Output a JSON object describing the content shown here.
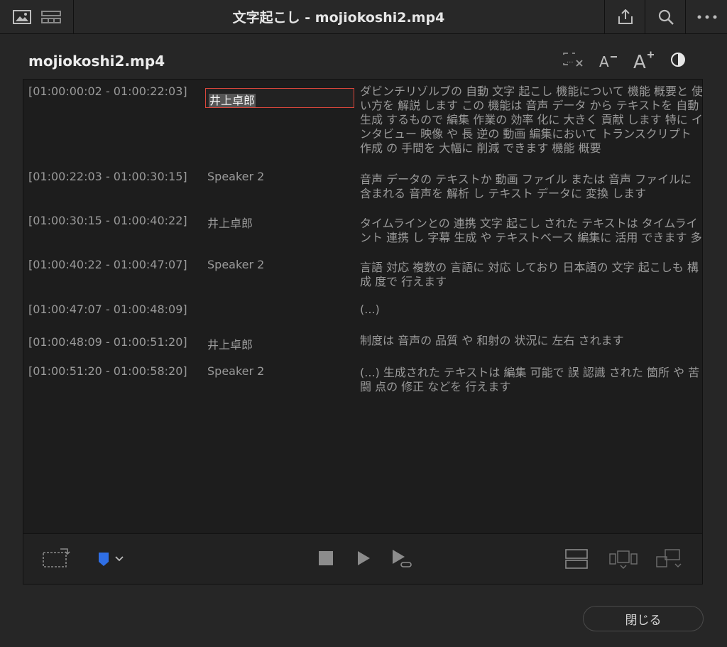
{
  "window": {
    "title": "文字起こし - mojiokoshi2.mp4"
  },
  "file_title": "mojiokoshi2.mp4",
  "rows": [
    {
      "tc": "[01:00:00:02 - 01:00:22:03]",
      "speaker": "井上卓郎",
      "text_pre": "",
      "text_hl": "",
      "text": "ダビンチリゾルブの 自動 文字 起こし 機能について 機能 概要と 使い方を 解説 します この 機能は 音声 データ から テキストを 自動 生成 するもので 編集 作業の 効率 化に 大きく 貢献 します 特に インタビュー 映像 や 長 逆の 動画 編集において トランスクリプト 作成 の 手間を 大幅に 削減 できます 機能 概要"
    },
    {
      "tc": "[01:00:22:03 - 01:00:30:15]",
      "speaker": "Speaker 2",
      "text": "音声 データの テキストか 動画 ファイル または 音声 ファイルに 含まれる 音声を 解析 し テキスト データに 変換 します"
    },
    {
      "tc": "[01:00:30:15 - 01:00:40:22]",
      "speaker": "井上卓郎",
      "text": "タイムラインとの 連携 文字 起こし された テキストは タイムライント 連携 し 字幕 生成 や テキストベース 編集に 活用 できます 多"
    },
    {
      "tc": "[01:00:40:22 - 01:00:47:07]",
      "speaker": "Speaker 2",
      "text": "言語 対応 複数の 言語に 対応 しており 日本語の 文字 起こしも 構成 度で 行えます"
    },
    {
      "tc": "[01:00:47:07 - 01:00:48:09]",
      "speaker": "",
      "text": "(...)"
    },
    {
      "tc": "[01:00:48:09 - 01:00:51:20]",
      "speaker": "井上卓郎",
      "text": "制度は 音声の 品質 や 和射の 状況に 左右 されます"
    },
    {
      "tc": "[01:00:51:20 - 01:00:58:20]",
      "speaker": "Speaker 2",
      "text": "(...) 生成された テキストは 編集 可能で 誤 認識 された 箇所 や 苦闘 点の 修正 などを 行えます"
    }
  ],
  "close_label": "閉じる",
  "colors": {
    "accent_red": "#d9463b",
    "highlight": "#2a5e5a",
    "marker_blue": "#2f6fe6"
  }
}
